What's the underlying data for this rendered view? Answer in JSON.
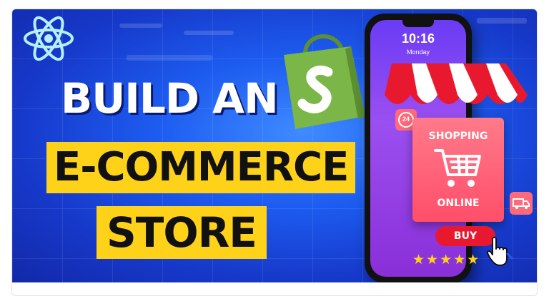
{
  "thumbnail": {
    "headline": {
      "line1": "BUILD AN",
      "line2": "E-COMMERCE",
      "line3": "STORE"
    },
    "phone": {
      "time": "10:16",
      "day": "Monday"
    },
    "shop_sign": {
      "top": "SHOPPING",
      "bottom": "ONLINE"
    },
    "badge": "24",
    "buy_button": "BUY",
    "rating": 5,
    "stars": "★★★★★",
    "icons": [
      "react-logo-icon",
      "shopify-bag-icon",
      "cart-icon",
      "truck-icon",
      "hand-pointer-icon",
      "star-icon"
    ],
    "colors": {
      "background": "#1d5cf0",
      "highlight": "#ffd21a",
      "sign": "#ff4e6a",
      "buy": "#e8182e",
      "shopify_green": "#7ab648"
    }
  }
}
